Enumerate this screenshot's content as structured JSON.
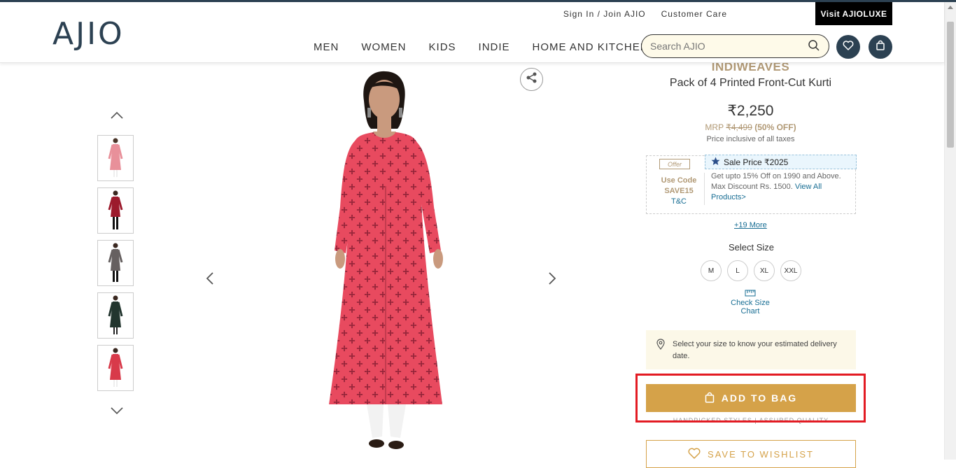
{
  "header": {
    "logo": "AJIO",
    "signin": "Sign In / Join AJIO",
    "customer_care": "Customer Care",
    "luxe": "Visit AJIOLUXE",
    "nav": [
      "MEN",
      "WOMEN",
      "KIDS",
      "INDIE",
      "HOME AND KITCHEN"
    ],
    "search_placeholder": "Search AJIO"
  },
  "product": {
    "brand": "INDIWEAVES",
    "name": "Pack of 4 Printed Front-Cut Kurti",
    "price": "₹2,250",
    "mrp_label": "MRP",
    "mrp_value": "₹4,499",
    "discount": "(50% OFF)",
    "tax_note": "Price inclusive of all taxes",
    "thumbnails": [
      {
        "color": "#e8909a"
      },
      {
        "color": "#9c1a2c"
      },
      {
        "color": "#666060"
      },
      {
        "color": "#22352e"
      },
      {
        "color": "#d83a4a"
      }
    ]
  },
  "offer": {
    "tag": "Offer",
    "use_code_label": "Use Code",
    "code": "SAVE15",
    "tnc": "T&C",
    "sale_price": "Sale Price ₹2025",
    "description": "Get upto 15% Off on 1990 and Above. Max Discount Rs. 1500.",
    "view_all": "View All Products>",
    "more": "+19 More"
  },
  "sizes": {
    "label": "Select Size",
    "options": [
      "M",
      "L",
      "XL",
      "XXL"
    ],
    "size_chart": "Check Size Chart"
  },
  "delivery": {
    "text": "Select your size to know your estimated delivery date."
  },
  "actions": {
    "add_to_bag": "ADD TO BAG",
    "assured": "HANDPICKED STYLES | ASSURED QUALITY",
    "wishlist": "SAVE TO WISHLIST"
  },
  "colors": {
    "brand_navy": "#2c4152",
    "gold": "#d5a249",
    "highlight_red": "#e31b23",
    "kurti_red": "#e84a5f"
  }
}
